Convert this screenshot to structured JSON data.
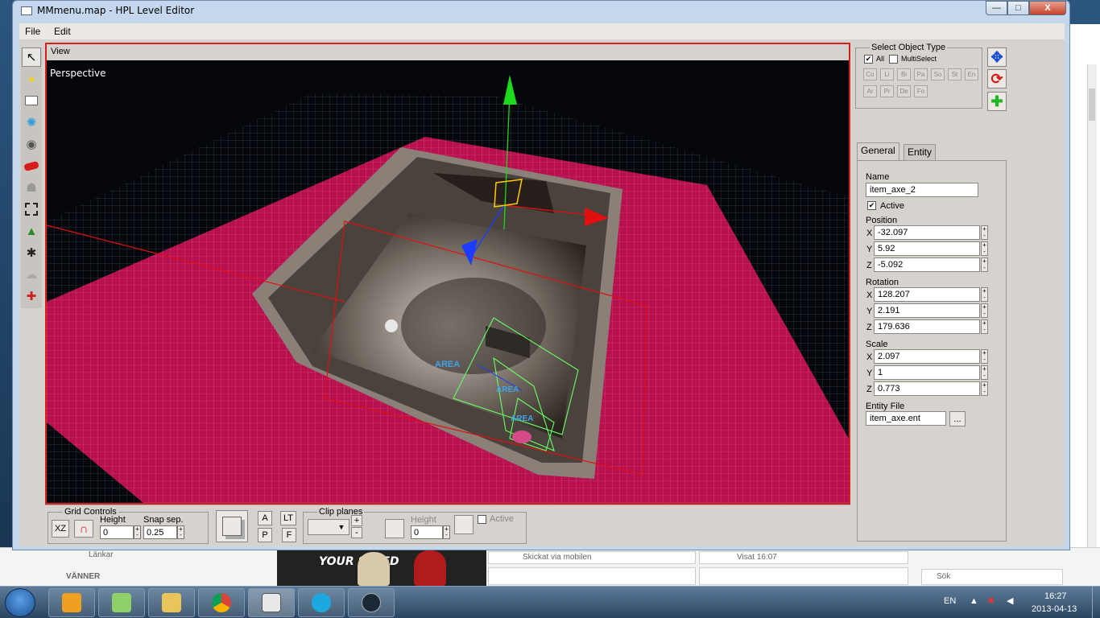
{
  "window": {
    "title": "MMmenu.map - HPL Level Editor",
    "close": "X",
    "minimize": "—",
    "maximize": "□"
  },
  "menu": {
    "file": "File",
    "edit": "Edit"
  },
  "tools": [
    "select-arrow-icon",
    "light-bulb-icon",
    "billboard-icon",
    "particle-atom-icon",
    "sound-icon",
    "primitive-capsule-icon",
    "decal-ghost-icon",
    "area-box-icon",
    "static-object-icon",
    "entity-gear-icon",
    "fog-icon",
    "combine-icon"
  ],
  "view": {
    "panel_label": "View",
    "mode_label": "Perspective",
    "area_labels": [
      "AREA",
      "AREA",
      "AREA"
    ]
  },
  "grid_controls": {
    "title": "Grid Controls",
    "plane_button": "XZ",
    "height_label": "Height",
    "height_value": "0",
    "snap_label": "Snap sep.",
    "snap_value": "0.25"
  },
  "view_buttons": {
    "a": "A",
    "p": "P",
    "lt": "LT",
    "f": "F"
  },
  "clip_planes": {
    "title": "Clip planes",
    "add": "+",
    "remove": "-",
    "height_label": "Height",
    "height_value": "0",
    "active_label": "Active"
  },
  "select_object_type": {
    "title": "Select Object Type",
    "all_label": "All",
    "all_checked": true,
    "multiselect_label": "MultiSelect",
    "multiselect_checked": false,
    "types_row1": [
      "Co",
      "Li",
      "Bi",
      "Pa",
      "So",
      "St",
      "En"
    ],
    "types_row2": [
      "Ar",
      "Pr",
      "De",
      "Fo"
    ]
  },
  "transform_buttons": {
    "translate": "✥",
    "rotate": "⟳",
    "scale": "✚"
  },
  "tabs": {
    "general": "General",
    "entity": "Entity",
    "active_tab": "General"
  },
  "general": {
    "name_label": "Name",
    "name_value": "item_axe_2",
    "active_label": "Active",
    "active_checked": true,
    "position_label": "Position",
    "position": {
      "x": "-32.097",
      "y": "5.92",
      "z": "-5.092"
    },
    "rotation_label": "Rotation",
    "rotation": {
      "x": "128.207",
      "y": "2.191",
      "z": "179.636"
    },
    "scale_label": "Scale",
    "scale": {
      "x": "2.097",
      "y": "1",
      "z": "0.773"
    },
    "axis_x": "X",
    "axis_y": "Y",
    "axis_z": "Z",
    "entity_file_label": "Entity File",
    "entity_file_value": "item_axe.ent",
    "browse_button": "..."
  },
  "background": {
    "links_label": "Länkar",
    "friends_label": "VÄNNER",
    "sent_label": "Skickat via mobilen",
    "seen_label": "Visat 16:07",
    "search_label": "Sök",
    "promo_text": "YOUR SPEED"
  },
  "taskbar": {
    "apps": [
      "media-player-icon",
      "notepad-icon",
      "explorer-folder-icon",
      "chrome-icon",
      "level-editor-icon",
      "skype-icon",
      "steam-icon"
    ],
    "active_index": 4,
    "language": "EN",
    "time": "16:27",
    "date": "2013-04-13"
  },
  "colors": {
    "viewport_border": "#d31f1f",
    "grid_pink": "#c4145a",
    "gizmo_green": "#1ed81e",
    "gizmo_red": "#e01010",
    "gizmo_blue": "#1a3cff",
    "area_green": "#66ff66"
  }
}
